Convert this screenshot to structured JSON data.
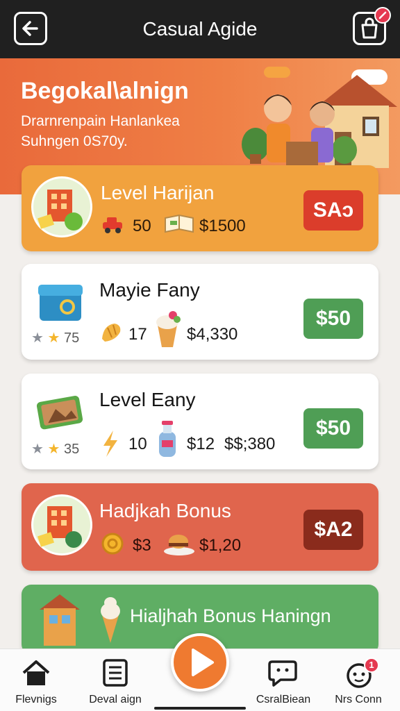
{
  "header": {
    "title": "Casual Agide"
  },
  "banner": {
    "title": "Begokal\\alnign",
    "subtitle_line1": "Drarnrenpain Hanlankea",
    "subtitle_line2": "Suhngen 0S70y."
  },
  "cards": [
    {
      "title": "Level Harijan",
      "stat1": "50",
      "stat2": "$1500",
      "price": "SAɔ",
      "bg": "#f1a23e",
      "button": "#db3d2b"
    },
    {
      "title": "Mayie Fany",
      "rating": "75",
      "stat1": "17",
      "stat2": "$4,330",
      "price": "$50",
      "bg": "#ffffff",
      "button": "#4f9e55"
    },
    {
      "title": "Level Eany",
      "rating": "35",
      "stat1": "10",
      "stat2": "$12",
      "stat3": "$$;380",
      "price": "$50",
      "bg": "#ffffff",
      "button": "#4f9e55"
    },
    {
      "title": "Hadjkah Bonus",
      "stat1": "$3",
      "stat2": "$1,20",
      "price": "$A2",
      "bg": "#e0654d",
      "button": "#8a2b1c"
    },
    {
      "title": "Hialjhah Bonus Haningn",
      "bg": "#5fae64"
    }
  ],
  "nav": [
    {
      "label": "Flevnigs",
      "icon": "home-icon"
    },
    {
      "label": "Deval aign",
      "icon": "list-icon"
    },
    {
      "label": "",
      "icon": "play-icon"
    },
    {
      "label": "CsralBiean",
      "icon": "chat-bubble-icon"
    },
    {
      "label": "Nrs Conn",
      "icon": "mascot-icon"
    }
  ],
  "colors": {
    "topbar": "#202020",
    "banner": "#ec7240",
    "accent": "#ef7a30"
  }
}
